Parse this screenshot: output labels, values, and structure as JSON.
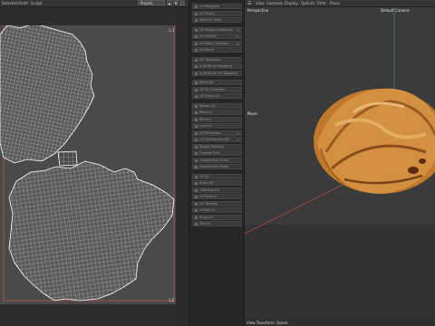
{
  "uv_editor": {
    "menu": [
      "Selection",
      "Paint",
      "Sculpt"
    ],
    "project_select": "Project",
    "corner_top": "1,1",
    "corner_bottom": "1,0"
  },
  "command_panel": {
    "buttons": [
      {
        "label": "UV Polygons",
        "toggle": false
      },
      {
        "label": "UV Points",
        "toggle": false
      },
      {
        "label": "Paint UV Tools",
        "toggle": false
      },
      {
        "label": "UV Polygon Selection",
        "toggle": true
      },
      {
        "label": "UV Islands",
        "toggle": true
      },
      {
        "label": "UV Mesh Selection",
        "toggle": true
      },
      {
        "label": "UV Mirror",
        "toggle": false
      },
      {
        "label": "UV Transform",
        "toggle": false
      },
      {
        "label": "Auto Mirror Mapping",
        "toggle": false
      },
      {
        "label": "Auto Mirror UV Mapping",
        "toggle": false
      },
      {
        "label": "Move UV",
        "toggle": false
      },
      {
        "label": "UV Pin Selection",
        "toggle": false
      },
      {
        "label": "UV Unpin All",
        "toggle": false
      },
      {
        "label": "Rotate UV",
        "toggle": false
      },
      {
        "label": "Mirror U",
        "toggle": false
      },
      {
        "label": "Mirror V",
        "toggle": false
      },
      {
        "label": "Lock UV",
        "toggle": false
      },
      {
        "label": "UV Relaxation",
        "toggle": true
      },
      {
        "label": "UV Packing Islands",
        "toggle": true
      },
      {
        "label": "Region Packing",
        "toggle": false
      },
      {
        "label": "Overlap Grid",
        "toggle": false
      },
      {
        "label": "Grow/Shrink Order",
        "toggle": false
      },
      {
        "label": "Grow/Shrink Mode",
        "toggle": false
      },
      {
        "label": "Fit UV",
        "toggle": false
      },
      {
        "label": "Scale UV",
        "toggle": false
      },
      {
        "label": "Optimize UV",
        "toggle": false
      },
      {
        "label": "UV Sewing",
        "toggle": false
      },
      {
        "label": "UV Tweaker",
        "toggle": false
      },
      {
        "label": "Unfold UV",
        "toggle": false
      },
      {
        "label": "Snap UV",
        "toggle": false
      },
      {
        "label": "Tile UV",
        "toggle": false
      }
    ]
  },
  "viewport": {
    "menu": [
      "View",
      "Cameras",
      "Display",
      "Options",
      "Filter",
      "Panel"
    ],
    "view_name": "Perspective",
    "camera_name": "Default Camera",
    "tool_label": "Move",
    "status": "View Transform: Scene"
  },
  "colors": {
    "accent_uv_frame": "#d9534f",
    "axis_green": "#3fa36a",
    "axis_red": "#c25555",
    "walnut_base": "#c0782a"
  }
}
